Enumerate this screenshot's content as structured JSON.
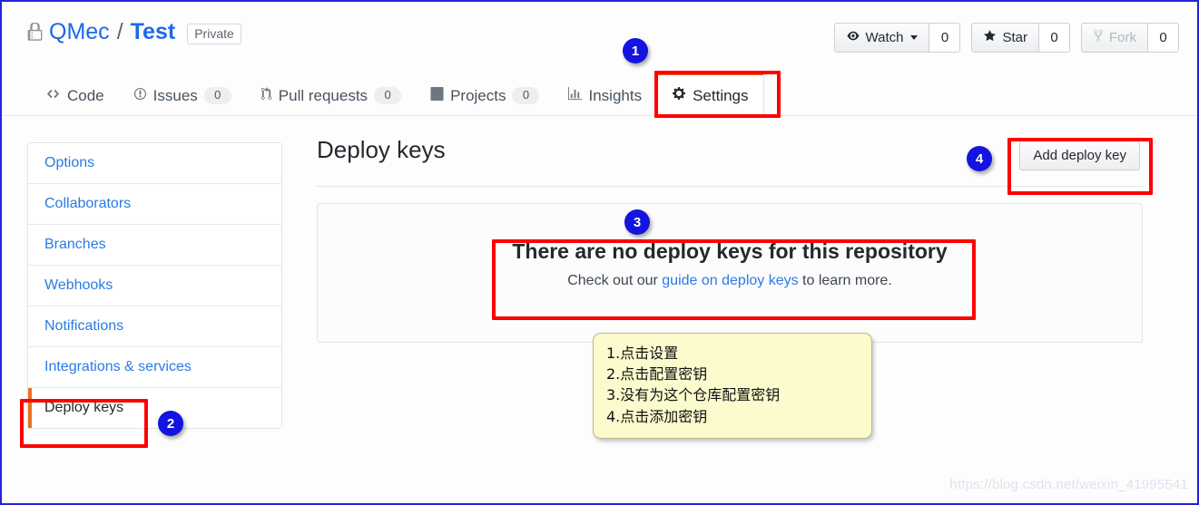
{
  "repo": {
    "lock_icon": "lock-icon",
    "owner": "QMec",
    "separator": "/",
    "name": "Test",
    "visibility": "Private"
  },
  "header_actions": [
    {
      "icon": "eye-icon",
      "label": "Watch",
      "count": "0",
      "has_caret": true,
      "disabled": false
    },
    {
      "icon": "star-icon",
      "label": "Star",
      "count": "0",
      "has_caret": false,
      "disabled": false
    },
    {
      "icon": "fork-icon",
      "label": "Fork",
      "count": "0",
      "has_caret": false,
      "disabled": true
    }
  ],
  "tabs": [
    {
      "icon": "code-icon",
      "label": "Code",
      "count": null,
      "active": false
    },
    {
      "icon": "issue-opened-icon",
      "label": "Issues",
      "count": "0",
      "active": false
    },
    {
      "icon": "git-pull-request-icon",
      "label": "Pull requests",
      "count": "0",
      "active": false
    },
    {
      "icon": "project-icon",
      "label": "Projects",
      "count": "0",
      "active": false
    },
    {
      "icon": "graph-icon",
      "label": "Insights",
      "count": null,
      "active": false
    },
    {
      "icon": "gear-icon",
      "label": "Settings",
      "count": null,
      "active": true
    }
  ],
  "sidebar": {
    "items": [
      {
        "label": "Options",
        "active": false
      },
      {
        "label": "Collaborators",
        "active": false
      },
      {
        "label": "Branches",
        "active": false
      },
      {
        "label": "Webhooks",
        "active": false
      },
      {
        "label": "Notifications",
        "active": false
      },
      {
        "label": "Integrations & services",
        "active": false
      },
      {
        "label": "Deploy keys",
        "active": true
      }
    ]
  },
  "main": {
    "title": "Deploy keys",
    "add_button_label": "Add deploy key",
    "empty_state": {
      "title": "There are no deploy keys for this repository",
      "desc_before": "Check out our ",
      "link_text": "guide on deploy keys",
      "desc_after": " to learn more."
    }
  },
  "annotations": {
    "badges": [
      {
        "number": "1",
        "target": "settings-tab"
      },
      {
        "number": "2",
        "target": "sidebar-deploy-keys"
      },
      {
        "number": "3",
        "target": "empty-state"
      },
      {
        "number": "4",
        "target": "add-deploy-key-button"
      }
    ],
    "box_color": "#ff0000",
    "badge_color": "#1414e0"
  },
  "note": {
    "lines": [
      "1.点击设置",
      "2.点击配置密钥",
      "3.没有为这个仓库配置密钥",
      "4.点击添加密钥"
    ]
  },
  "watermark": "https://blog.csdn.net/weixin_41995541",
  "colors": {
    "accent_orange": "#e8721c",
    "link_blue": "#2a7ae4",
    "annotation_red": "#ff0000",
    "badge_blue": "#1414e0",
    "note_yellow": "#fbfbce"
  }
}
